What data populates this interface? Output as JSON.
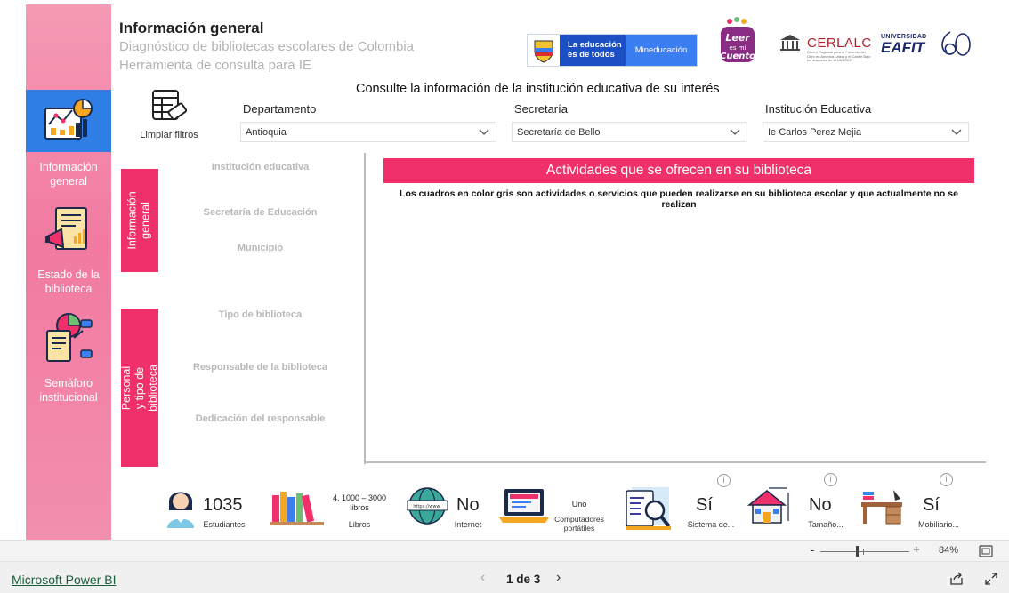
{
  "header": {
    "title": "Información general",
    "subtitle_line1": "Diagnóstico de bibliotecas escolares de Colombia",
    "subtitle_line2": "Herramienta de consulta para IE"
  },
  "logos": {
    "mineducacion_tagline": "La educación es de todos",
    "mineducacion_name": "Mineducación",
    "leer_cuento": "Leer es mi Cuento",
    "cerlalc": "CERLALC",
    "cerlalc_desc": "Centro Regional para el Fomento del Libro en América Latina y el Caribe Bajo los auspicios de la UNESCO",
    "eafit_university": "UNIVERSIDAD",
    "eafit_name": "EAFIT"
  },
  "sidebar": {
    "items": [
      {
        "label": "Información general",
        "icon": "dashboard-analytics-icon",
        "active": true
      },
      {
        "label": "Estado de la biblioteca",
        "icon": "report-megaphone-icon",
        "active": false
      },
      {
        "label": "Semáforo institucional",
        "icon": "pie-chart-document-icon",
        "active": false
      }
    ]
  },
  "filters": {
    "heading": "Consulte la información de la institución educativa de su interés",
    "clear_label": "Limpiar filtros",
    "departamento": {
      "label": "Departamento",
      "value": "Antioquia"
    },
    "secretaria": {
      "label": "Secretaría",
      "value": "Secretaría de Bello"
    },
    "institucion": {
      "label": "Institución Educativa",
      "value": "Ie Carlos Perez Mejia"
    }
  },
  "general_info": {
    "header": "Información general",
    "fields": [
      "Institución educativa",
      "Secretaría de Educación",
      "Municipio"
    ]
  },
  "staff_info": {
    "header": "Personal y tipo de biblioteca",
    "fields": [
      "Tipo de biblioteca",
      "Responsable de la biblioteca",
      "Dedicación del responsable"
    ]
  },
  "activities": {
    "title": "Actividades que se ofrecen en su biblioteca",
    "note": "Los cuadros en color gris son actividades o servicios que pueden realizarse en su biblioteca escolar y que actualmente no se realizan"
  },
  "kpis": {
    "students": {
      "value": "1035",
      "label": "Estudiantes"
    },
    "books": {
      "value": "4. 1000 – 3000 libros",
      "label": "Libros"
    },
    "internet": {
      "value": "No",
      "label": "Internet"
    },
    "computers": {
      "value": "Uno",
      "label": "Computadores portátiles"
    },
    "system": {
      "value": "Sí",
      "label": "Sistema de..."
    },
    "size": {
      "value": "No",
      "label": "Tamaño..."
    },
    "furniture": {
      "value": "Sí",
      "label": "Mobiliario..."
    },
    "info_glyph": "i"
  },
  "zoombar": {
    "minus": "-",
    "plus": "+",
    "zoom_level": "84%"
  },
  "footer": {
    "brand": "Microsoft Power BI",
    "page_indicator": "1 de 3",
    "prev": "‹",
    "next": "›"
  }
}
